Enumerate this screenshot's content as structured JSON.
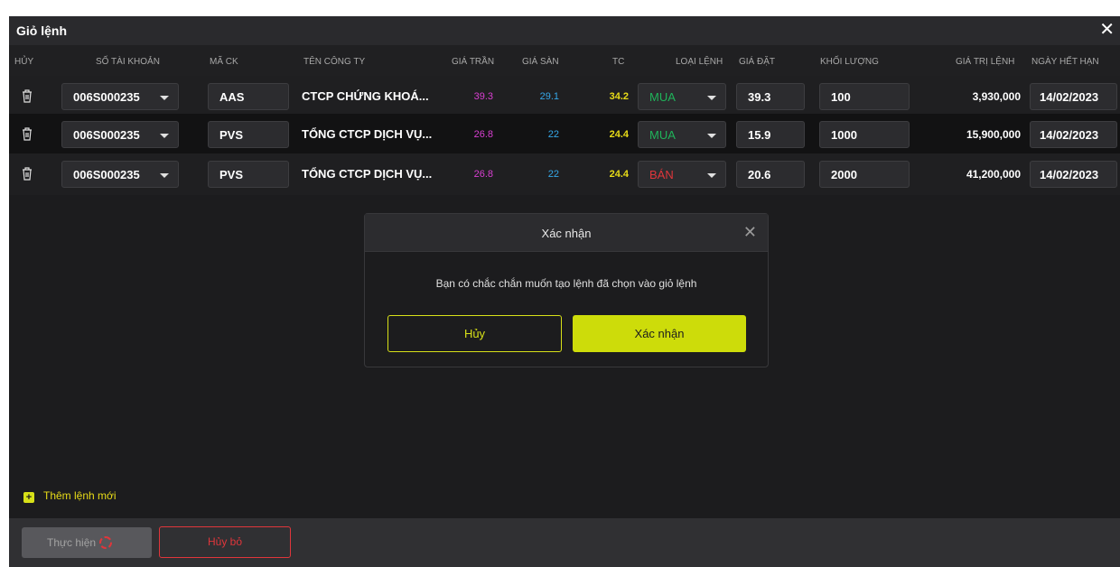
{
  "header": {
    "title": "Giỏ lệnh",
    "close_icon": "close-icon"
  },
  "columns": {
    "cancel": "HỦY",
    "account": "SỐ TÀI KHOẢN",
    "symbol": "MÃ CK",
    "company": "TÊN CÔNG TY",
    "ceiling": "GIÁ TRẦN",
    "floor": "GIÁ SÀN",
    "ref": "TC",
    "order_type": "LOẠI LỆNH",
    "price": "GIÁ ĐẶT",
    "qty": "KHỐI LƯỢNG",
    "value": "GIÁ TRỊ LỆNH",
    "expiry": "NGÀY HẾT HẠN"
  },
  "rows": [
    {
      "account": "006S000235",
      "symbol": "AAS",
      "company": "CTCP CHỨNG KHOÁ...",
      "ceiling": "39.3",
      "floor": "29.1",
      "ref": "34.2",
      "order_type": "MUA",
      "price": "39.3",
      "qty": "100",
      "value": "3,930,000",
      "expiry": "14/02/2023"
    },
    {
      "account": "006S000235",
      "symbol": "PVS",
      "company": "TỔNG CTCP DỊCH VỤ...",
      "ceiling": "26.8",
      "floor": "22",
      "ref": "24.4",
      "order_type": "MUA",
      "price": "15.9",
      "qty": "1000",
      "value": "15,900,000",
      "expiry": "14/02/2023"
    },
    {
      "account": "006S000235",
      "symbol": "PVS",
      "company": "TỔNG CTCP DỊCH VỤ...",
      "ceiling": "26.8",
      "floor": "22",
      "ref": "24.4",
      "order_type": "BÁN",
      "price": "20.6",
      "qty": "2000",
      "value": "41,200,000",
      "expiry": "14/02/2023"
    }
  ],
  "add_new_label": "Thêm lệnh mới",
  "footer": {
    "execute_label": "Thực hiện",
    "cancel_label": "Hủy bỏ"
  },
  "modal": {
    "title": "Xác nhận",
    "message": "Bạn có chắc chắn muốn tạo lệnh đã chọn vào giỏ lệnh",
    "cancel_label": "Hủy",
    "confirm_label": "Xác nhận"
  },
  "colors": {
    "accent": "#cddc0a",
    "buy": "#1fb35a",
    "sell": "#e0363b",
    "ceiling": "#d93fd2",
    "floor": "#35a7e8",
    "ref": "#e8dc18"
  }
}
